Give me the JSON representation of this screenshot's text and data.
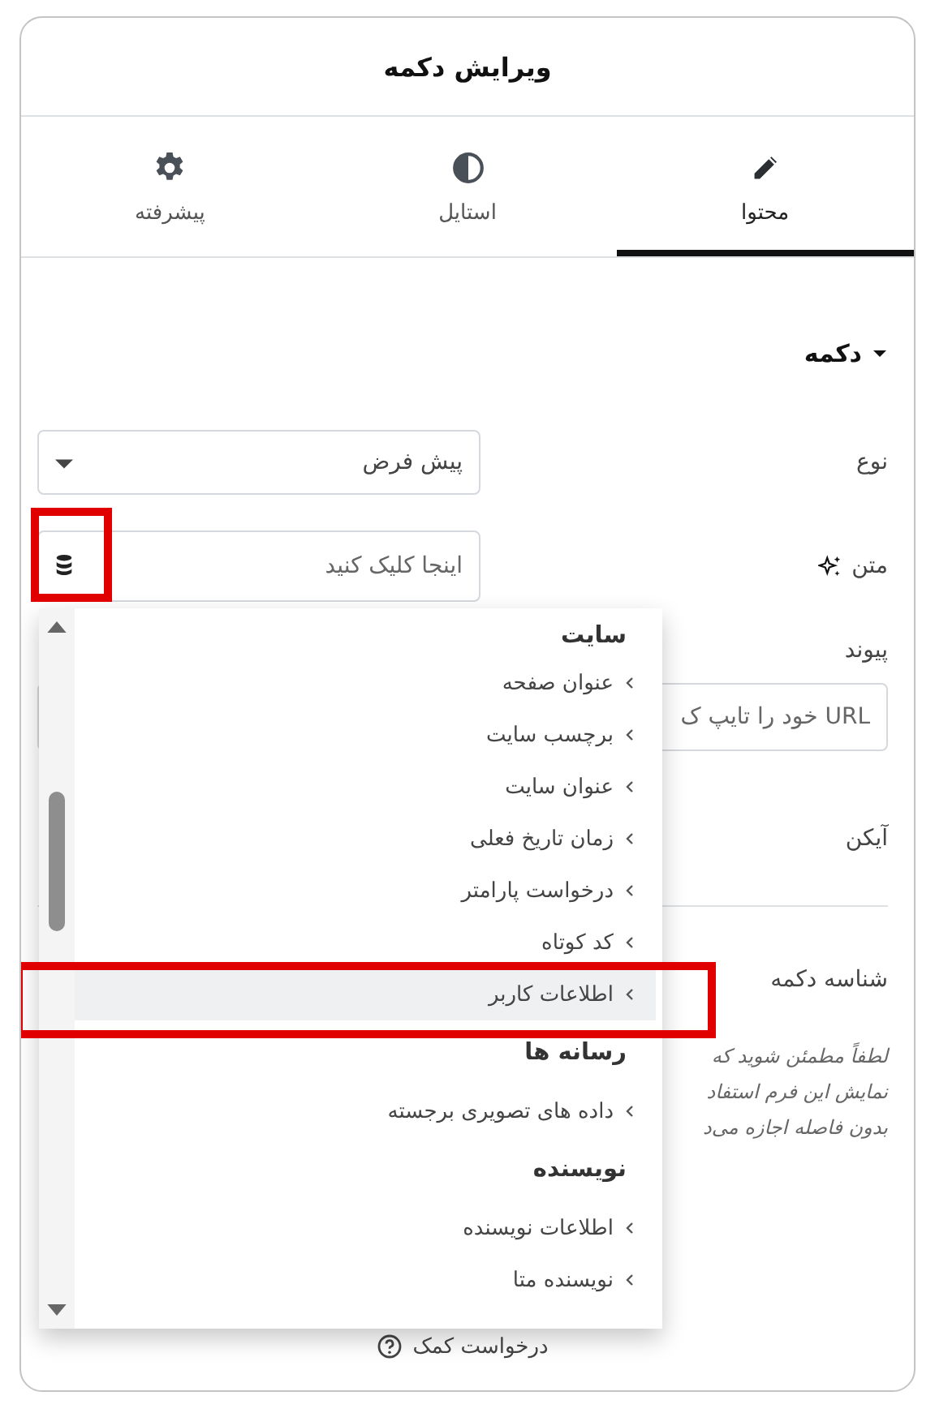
{
  "panel": {
    "title": "ویرایش دکمه"
  },
  "tabs": [
    {
      "label": "محتوا",
      "selected": true
    },
    {
      "label": "استایل",
      "selected": false
    },
    {
      "label": "پیشرفته",
      "selected": false
    }
  ],
  "section": {
    "title": "دکمه",
    "expanded": true
  },
  "fields": [
    {
      "kind": "select",
      "label": "نوع",
      "value": "پیش فرض"
    },
    {
      "kind": "dynamic",
      "label": "متن",
      "placeholder": "اینجا کلیک کنید"
    },
    {
      "kind": "url",
      "label": "پیوند",
      "placeholder": "URL خود را تایپ ک"
    },
    {
      "kind": "plain",
      "label": "آیکن"
    },
    {
      "kind": "divider"
    },
    {
      "kind": "plain",
      "label": "شناسه دکمه"
    }
  ],
  "note": [
    "لطفاً مطمئن شوید که",
    "نمایش این فرم استفاد",
    "بدون فاصله اجازه می‌د"
  ],
  "help_link": "درخواست کمک",
  "dropdown": {
    "groups": [
      {
        "title": "سایت",
        "items": [
          {
            "label": "عنوان صفحه",
            "selected": false
          },
          {
            "label": "برچسب سایت",
            "selected": false
          },
          {
            "label": "عنوان سایت",
            "selected": false
          },
          {
            "label": "زمان تاریخ فعلی",
            "selected": false
          },
          {
            "label": "درخواست پارامتر",
            "selected": false
          },
          {
            "label": "کد کوتاه",
            "selected": false
          },
          {
            "label": "اطلاعات کاربر",
            "selected": true
          }
        ]
      },
      {
        "title": "رسانه ها",
        "items": [
          {
            "label": "داده های تصویری برجسته",
            "selected": false
          }
        ]
      },
      {
        "title": "نویسنده",
        "items": [
          {
            "label": "اطلاعات نویسنده",
            "selected": false
          },
          {
            "label": "نویسنده متا",
            "selected": false
          }
        ]
      }
    ]
  }
}
